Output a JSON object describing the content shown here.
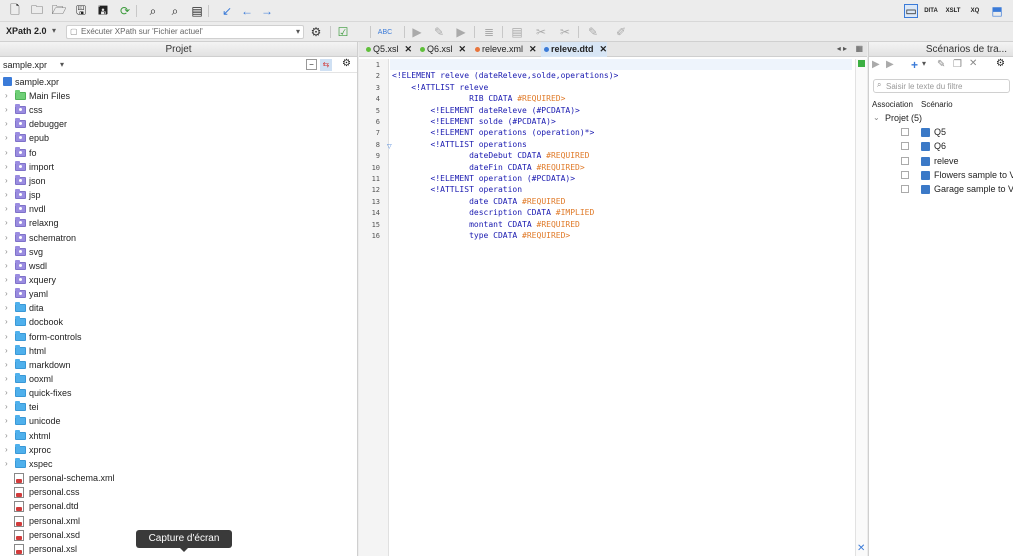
{
  "toolbar": {
    "xpath_version": "XPath 2.0",
    "xpath_placeholder": "Exécuter XPath sur  'Fichier actuel'"
  },
  "project_panel": {
    "title": "Projet",
    "selector": "sample.xpr",
    "root": "sample.xpr",
    "items": [
      {
        "label": "Main Files",
        "type": "green"
      },
      {
        "label": "css",
        "type": "purple"
      },
      {
        "label": "debugger",
        "type": "purple"
      },
      {
        "label": "epub",
        "type": "purple"
      },
      {
        "label": "fo",
        "type": "purple"
      },
      {
        "label": "import",
        "type": "purple"
      },
      {
        "label": "json",
        "type": "purple"
      },
      {
        "label": "jsp",
        "type": "purple"
      },
      {
        "label": "nvdl",
        "type": "purple"
      },
      {
        "label": "relaxng",
        "type": "purple"
      },
      {
        "label": "schematron",
        "type": "purple"
      },
      {
        "label": "svg",
        "type": "purple"
      },
      {
        "label": "wsdl",
        "type": "purple"
      },
      {
        "label": "xquery",
        "type": "purple"
      },
      {
        "label": "yaml",
        "type": "purple"
      },
      {
        "label": "dita",
        "type": "blue"
      },
      {
        "label": "docbook",
        "type": "blue"
      },
      {
        "label": "form-controls",
        "type": "blue"
      },
      {
        "label": "html",
        "type": "blue"
      },
      {
        "label": "markdown",
        "type": "blue"
      },
      {
        "label": "ooxml",
        "type": "blue"
      },
      {
        "label": "quick-fixes",
        "type": "blue"
      },
      {
        "label": "tei",
        "type": "blue"
      },
      {
        "label": "unicode",
        "type": "blue"
      },
      {
        "label": "xhtml",
        "type": "blue"
      },
      {
        "label": "xproc",
        "type": "blue"
      },
      {
        "label": "xspec",
        "type": "blue"
      },
      {
        "label": "personal-schema.xml",
        "type": "file"
      },
      {
        "label": "personal.css",
        "type": "file"
      },
      {
        "label": "personal.dtd",
        "type": "file"
      },
      {
        "label": "personal.xml",
        "type": "file"
      },
      {
        "label": "personal.xsd",
        "type": "file"
      },
      {
        "label": "personal.xsl",
        "type": "file"
      }
    ]
  },
  "editor": {
    "tabs": [
      {
        "label": "Q5.xsl",
        "dot": "#5fbf3a"
      },
      {
        "label": "Q6.xsl",
        "dot": "#5fbf3a"
      },
      {
        "label": "releve.xml",
        "dot": "#e8743b"
      },
      {
        "label": "releve.dtd",
        "dot": "#3b7bd8"
      }
    ],
    "close_glyph": "✕",
    "line_numbers": [
      "1",
      "2",
      "3",
      "4",
      "5",
      "6",
      "7",
      "8",
      "9",
      "10",
      "11",
      "12",
      "13",
      "14",
      "15",
      "16"
    ],
    "lines": [
      {
        "a": "",
        "b": ""
      },
      {
        "a": "<!ELEMENT releve (dateReleve,solde,operations)>",
        "b": ""
      },
      {
        "a": "    <!ATTLIST releve",
        "b": ""
      },
      {
        "a": "                RIB CDATA ",
        "b": "#REQUIRED>"
      },
      {
        "a": "        <!ELEMENT dateReleve (#PCDATA)>",
        "b": ""
      },
      {
        "a": "        <!ELEMENT solde (#PCDATA)>",
        "b": ""
      },
      {
        "a": "        <!ELEMENT operations (operation)*>",
        "b": ""
      },
      {
        "a": "        <!ATTLIST operations",
        "b": ""
      },
      {
        "a": "                dateDebut CDATA ",
        "b": "#REQUIRED"
      },
      {
        "a": "                dateFin CDATA ",
        "b": "#REQUIRED>"
      },
      {
        "a": "        <!ELEMENT operation (#PCDATA)>",
        "b": ""
      },
      {
        "a": "        <!ATTLIST operation",
        "b": ""
      },
      {
        "a": "                date CDATA ",
        "b": "#REQUIRED"
      },
      {
        "a": "                description CDATA ",
        "b": "#IMPLIED"
      },
      {
        "a": "                montant CDATA ",
        "b": "#REQUIRED"
      },
      {
        "a": "                type CDATA ",
        "b": "#REQUIRED>"
      }
    ]
  },
  "scenarios_panel": {
    "title": "Scénarios de tra...",
    "filter_placeholder": "Saisir le texte du filtre",
    "col_association": "Association",
    "col_scenario": "Scénario",
    "group": "Projet (5)",
    "items": [
      "Q5",
      "Q6",
      "releve",
      "Flowers sample to V",
      "Garage sample to V"
    ]
  },
  "tooltip": "Capture d'écran",
  "colors": {
    "accent": "#3b7bd8",
    "required": "#e07b2a",
    "code": "#1a1ab0"
  }
}
